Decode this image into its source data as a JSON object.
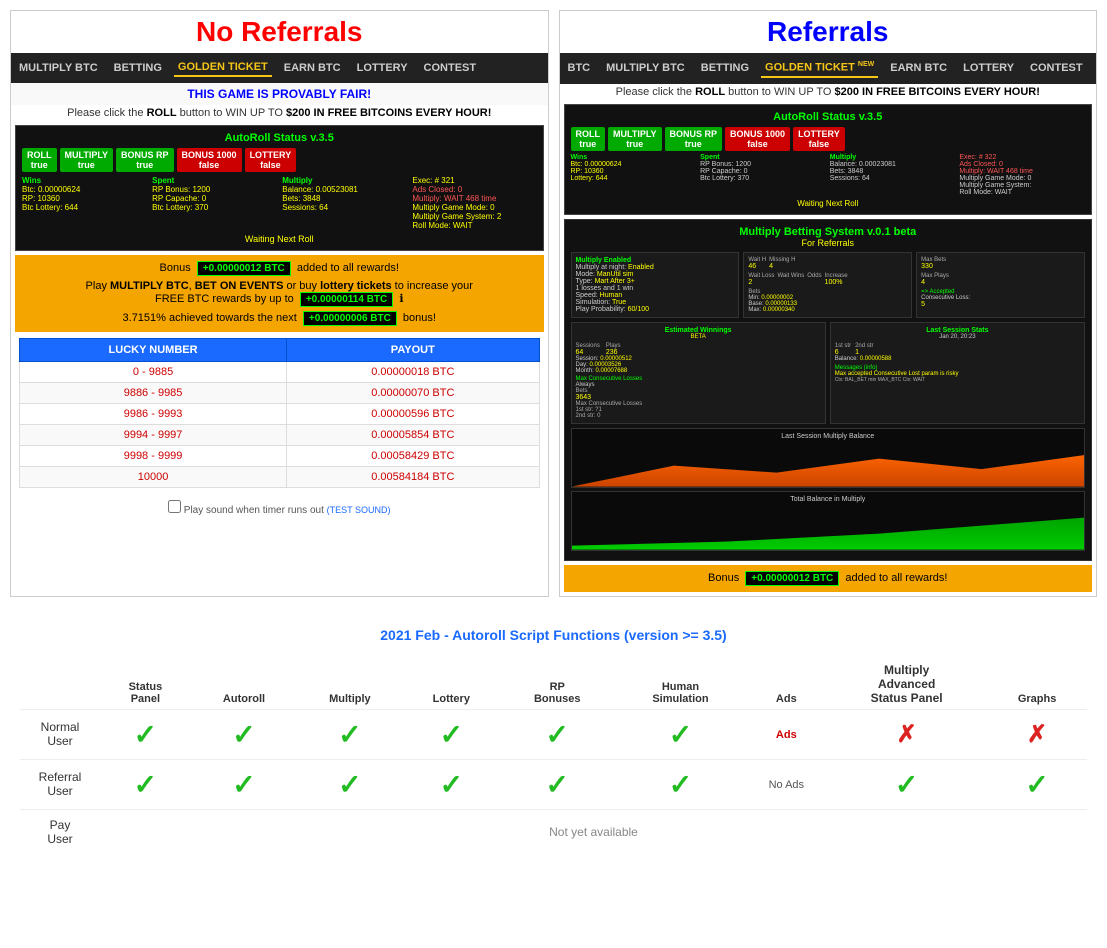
{
  "no_referrals": {
    "title": "No Referrals",
    "nav": {
      "items": [
        "MULTIPLY BTC",
        "BETTING",
        "GOLDEN TICKET",
        "EARN BTC",
        "LOTTERY",
        "CONTEST"
      ],
      "golden_index": 2
    },
    "provably_fair": "THIS GAME IS PROVABLY FAIR!",
    "win_text": "Please click the ROLL button to WIN UP TO $200 IN FREE BITCOINS EVERY HOUR!",
    "autoroll": {
      "title": "AutoRoll Status v.3.5",
      "buttons": [
        "ROLL true",
        "MULTIPLY true",
        "BONUS RP true",
        "BONUS 1000 false",
        "LOTTERY false"
      ],
      "exec_label": "Exec: # 321",
      "ads_closed": "Ads Closed: 0",
      "multiply": "Multiply: WAIT 468 time",
      "game_mode": "Multiply Game Mode: 0",
      "game_system": "Multiply Game System: 2",
      "roll_mode": "Roll Mode: WAIT",
      "wins": "Wins",
      "spent": "Spent",
      "multiply_col": "Multiply",
      "btc": "Btc: 0.00000624",
      "rp": "RP: 10360",
      "btc_lottery": "Btc Lottery: 644",
      "rp_bonus": "RP Bonus: 1200",
      "rp_capache": "RP Capache: 0",
      "btc_lottery2": "Btc Lottery: 370",
      "balance": "Balance: 0.00523081",
      "bets": "Bets: 3848",
      "sessions": "Sessions: 64",
      "waiting": "Waiting Next Roll"
    },
    "bonus": {
      "text1": "Bonus",
      "badge1": "+0.00000012 BTC",
      "text2": "added to all rewards!",
      "play_text": "Play MULTIPLY BTC, BET ON EVENTS or buy lottery tickets to increase your",
      "free_text": "FREE BTC rewards by up to",
      "badge2": "+0.00000114 BTC",
      "progress_text": "3.7151% achieved towards the next",
      "badge3": "+0.00000006 BTC",
      "progress_text2": "bonus!"
    },
    "table": {
      "col1": "LUCKY NUMBER",
      "col2": "PAYOUT",
      "rows": [
        {
          "range": "0 - 9885",
          "payout": "0.00000018 BTC"
        },
        {
          "range": "9886 - 9985",
          "payout": "0.00000070 BTC"
        },
        {
          "range": "9986 - 9993",
          "payout": "0.00000596 BTC"
        },
        {
          "range": "9994 - 9997",
          "payout": "0.00005854 BTC"
        },
        {
          "range": "9998 - 9999",
          "payout": "0.00058429 BTC"
        },
        {
          "range": "10000",
          "payout": "0.00584184 BTC"
        }
      ]
    },
    "sound_check": "☐ Play sound when timer runs out (TEST SOUND)"
  },
  "referrals": {
    "title": "Referrals",
    "nav": {
      "items": [
        "BTC",
        "MULTIPLY BTC",
        "BETTING",
        "GOLDEN TICKET",
        "EARN BTC",
        "LOTTERY",
        "CONTEST"
      ],
      "golden_index": 3
    },
    "win_text": "Please click the ROLL button to WIN UP TO $200 IN FREE BITCOINS EVERY HOUR!",
    "autoroll": {
      "title": "AutoRoll Status v.3.5",
      "waiting": "Waiting Next Roll"
    },
    "multiply_betting": {
      "title": "Multiply Betting System v.0.1 beta",
      "subtitle": "For Referrals",
      "settings": {
        "multiply_enabled": "Multiply Enabled",
        "multiply_at_night": "Multiply at night: Enabled",
        "mode": "Mode: ManUtil sim",
        "type": "Type: Mart After 3+",
        "losses_win": "1 losses and 1 win",
        "speed": "Speed: Human",
        "simulation": "Simulation: True",
        "play_probability": "Play Probability: 60/100"
      },
      "bets_info": {
        "wait_h": "Wait H",
        "wait_h_val": "46",
        "missing_h": "Missing H",
        "missing_h_val": "4",
        "wait_loss": "Wait Loss",
        "wait_loss_val": "2",
        "wait_wins": "Wait Wins",
        "wait_wins_val": "",
        "odds": "Odds",
        "increase": "Increase",
        "increase_val": "100%",
        "bets_label": "Bets",
        "min": "Min: 0.00000002",
        "base": "Base: 0.00000133",
        "max": "Max: 0.00000340",
        "max_bets": "Max Bets",
        "max_bets_val": "330",
        "max_plays": "Max Plays",
        "max_plays_val": "4",
        "accepted": "=> Accepted",
        "consecutive_loss": "Consecutive Loss:",
        "consecutive_val": "5"
      },
      "estimated": {
        "title": "Estimated Winnings",
        "beta": "BETA",
        "sessions_label": "Sessions",
        "sessions_val": "64",
        "plays_val": "236",
        "session_win": "Session: 0.00000512",
        "day_win": "Day: 0.00003526",
        "month_win": "Month: 0.00007688",
        "max_consec_loss_title": "Max Consecutive Losses",
        "always": "Always",
        "bets_val": "3643",
        "max_consec_detail": "1st str: ?1\n2nd str: 0"
      },
      "last_session": {
        "title": "Last Session Stats",
        "date": "Jan 20, 20:23",
        "label_1st": "1st str",
        "val_1st": "6",
        "label_2nd": "2nd str",
        "val_2nd": "1",
        "balance": "Balance: 0.00000588"
      },
      "graph1_label": "Last Session Multiply Balance",
      "graph2_label": "Total Balance in Multiply"
    },
    "bonus": {
      "text1": "Bonus",
      "badge1": "+0.00000012 BTC",
      "text2": "added to all rewards!"
    }
  },
  "feature_table": {
    "title": "2021 Feb - Autoroll Script Functions (version >= 3.5)",
    "columns": [
      {
        "label": "Status\nPanel",
        "bold": false
      },
      {
        "label": "Autoroll",
        "bold": false
      },
      {
        "label": "Multiply",
        "bold": false
      },
      {
        "label": "Lottery",
        "bold": false
      },
      {
        "label": "RP\nBonuses",
        "bold": false
      },
      {
        "label": "Human\nSimulation",
        "bold": false
      },
      {
        "label": "Ads",
        "bold": false
      },
      {
        "label": "Multiply\nAdvanced\nStatus Panel",
        "bold": true
      },
      {
        "label": "Graphs",
        "bold": false
      }
    ],
    "rows": [
      {
        "user_type": "Normal User",
        "checks": [
          "check",
          "check",
          "check",
          "check",
          "check",
          "check",
          "ads",
          "cross",
          "cross"
        ]
      },
      {
        "user_type": "Referral User",
        "checks": [
          "check",
          "check",
          "check",
          "check",
          "check",
          "check",
          "no-ads",
          "check",
          "check"
        ]
      },
      {
        "user_type": "Pay User",
        "checks": [
          "not-available"
        ]
      }
    ],
    "ads_label": "Ads",
    "no_ads_label": "No Ads",
    "not_yet_available": "Not yet available"
  }
}
